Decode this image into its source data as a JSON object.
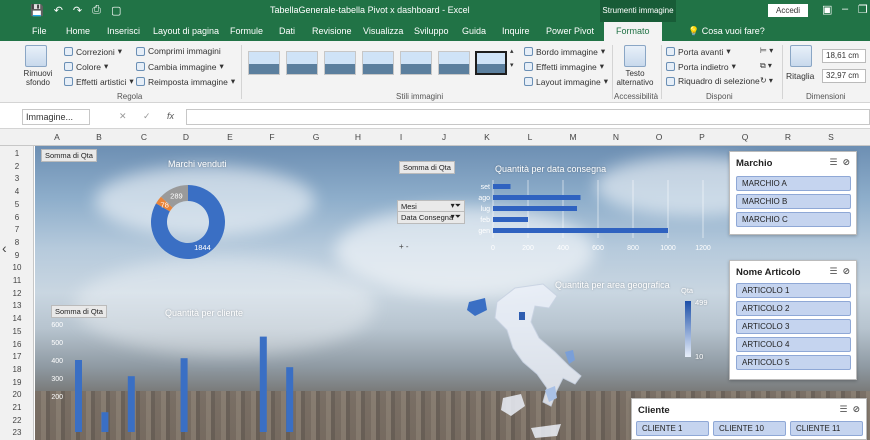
{
  "titlebar": {
    "title": "TabellaGenerale-tabella Pivot x dashboard  -  Excel",
    "context_tab": "Strumenti immagine",
    "signin": "Accedi"
  },
  "tabs": [
    "File",
    "Home",
    "Inserisci",
    "Layout di pagina",
    "Formule",
    "Dati",
    "Revisione",
    "Visualizza",
    "Sviluppo",
    "Guida",
    "Inquire",
    "Power Pivot",
    "Formato"
  ],
  "tell_me": "Cosa vuoi fare?",
  "ribbon": {
    "remove_bg": "Rimuovi sfondo",
    "corrections": "Correzioni",
    "color": "Colore",
    "artistic": "Effetti artistici",
    "compress": "Comprimi immagini",
    "change": "Cambia immagine",
    "reset": "Reimposta immagine",
    "group_regola": "Regola",
    "group_stili": "Stili immagini",
    "border": "Bordo immagine",
    "effects": "Effetti immagine",
    "layout": "Layout immagine",
    "alt_text": "Testo alternativo",
    "group_accessibilita": "Accessibilità",
    "forward": "Porta avanti",
    "backward": "Porta indietro",
    "selection": "Riquadro di selezione",
    "group_disponi": "Disponi",
    "crop": "Ritaglia",
    "height": "18,61 cm",
    "width": "32,97 cm",
    "group_dimensioni": "Dimensioni"
  },
  "namebox": "Immagine...",
  "columns": [
    "A",
    "B",
    "C",
    "D",
    "E",
    "F",
    "G",
    "H",
    "I",
    "J",
    "K",
    "L",
    "M",
    "N",
    "O",
    "P",
    "Q",
    "R",
    "S"
  ],
  "rows": [
    "1",
    "2",
    "3",
    "4",
    "5",
    "6",
    "7",
    "8",
    "9",
    "10",
    "11",
    "12",
    "13",
    "14",
    "15",
    "16",
    "17",
    "18",
    "19",
    "20",
    "21",
    "22",
    "23"
  ],
  "sheet": {
    "field_qta_1": "Somma  di Qta",
    "field_qta_2": "Somma  di Qta",
    "field_qta_3": "Somma  di Qta",
    "filter_mesi": "Mesi",
    "filter_data": "Data Consegna",
    "expand": "+ -",
    "map_legend_label": "Qta",
    "map_legend_max": "499",
    "map_legend_min": "10"
  },
  "slicers": {
    "marchio": {
      "title": "Marchio",
      "items": [
        "MARCHIO A",
        "MARCHIO B",
        "MARCHIO C"
      ]
    },
    "articolo": {
      "title": "Nome Articolo",
      "items": [
        "ARTICOLO 1",
        "ARTICOLO 2",
        "ARTICOLO 3",
        "ARTICOLO 4",
        "ARTICOLO 5"
      ]
    },
    "cliente": {
      "title": "Cliente",
      "items": [
        "CLIENTE 1",
        "CLIENTE 10",
        "CLIENTE 11"
      ]
    }
  },
  "chart_data": [
    {
      "type": "pie",
      "title": "Marchi venduti",
      "categories": [
        "",
        "",
        ""
      ],
      "values": [
        1844,
        78,
        289
      ],
      "colors": [
        "#3a6fc4",
        "#e8843a",
        "#9a9a9a"
      ]
    },
    {
      "type": "bar",
      "orientation": "horizontal",
      "title": "Quantità per data consegna",
      "categories": [
        "set",
        "ago",
        "lug",
        "feb",
        "gen"
      ],
      "values": [
        100,
        500,
        480,
        200,
        1000
      ],
      "xlim": [
        0,
        1200
      ],
      "xticks": [
        "0",
        "200",
        "400",
        "600",
        "800",
        "1000",
        "1200"
      ],
      "grid": true
    },
    {
      "type": "bar",
      "title": "Quantità per cliente",
      "categories": [
        "",
        "",
        "",
        "",
        "",
        "",
        "",
        "",
        "",
        "",
        "",
        "",
        "",
        "",
        "",
        "",
        "",
        "",
        ""
      ],
      "values": [
        400,
        0,
        110,
        0,
        310,
        0,
        0,
        0,
        410,
        0,
        0,
        0,
        0,
        0,
        530,
        0,
        360,
        0,
        0
      ],
      "ylim": [
        0,
        600
      ],
      "yticks": [
        "600",
        "500",
        "400",
        "300",
        "200"
      ],
      "series_color": "#3a6fc4"
    }
  ],
  "map": {
    "title": "Quantità per area geografica"
  }
}
